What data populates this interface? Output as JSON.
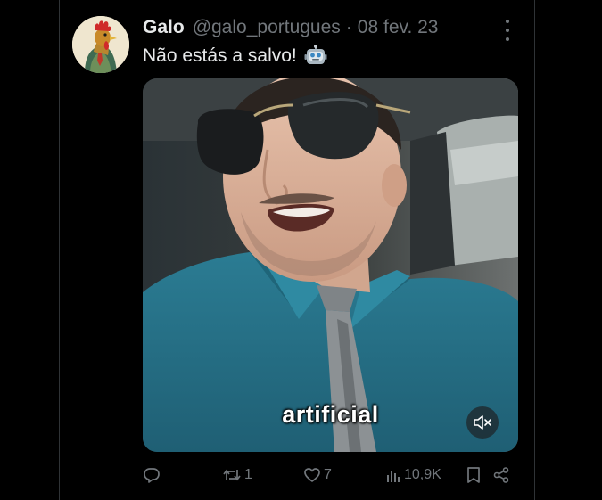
{
  "tweet": {
    "author_name": "Galo",
    "handle": "@galo_portugues",
    "separator": "·",
    "date": "08 fev. 23",
    "text": "Não estás a salvo!",
    "emoji_icon": "robot-icon"
  },
  "media": {
    "caption": "artificial",
    "mute_icon": "speaker-muted-icon"
  },
  "actions": {
    "reply_icon": "reply-icon",
    "retweet_count": "1",
    "like_count": "7",
    "views_count": "10,9K",
    "bookmark_icon": "bookmark-icon",
    "share_icon": "share-icon"
  },
  "colors": {
    "background": "#000000",
    "text_primary": "#e7e9ea",
    "text_secondary": "#71767b",
    "border": "#2f3336"
  }
}
